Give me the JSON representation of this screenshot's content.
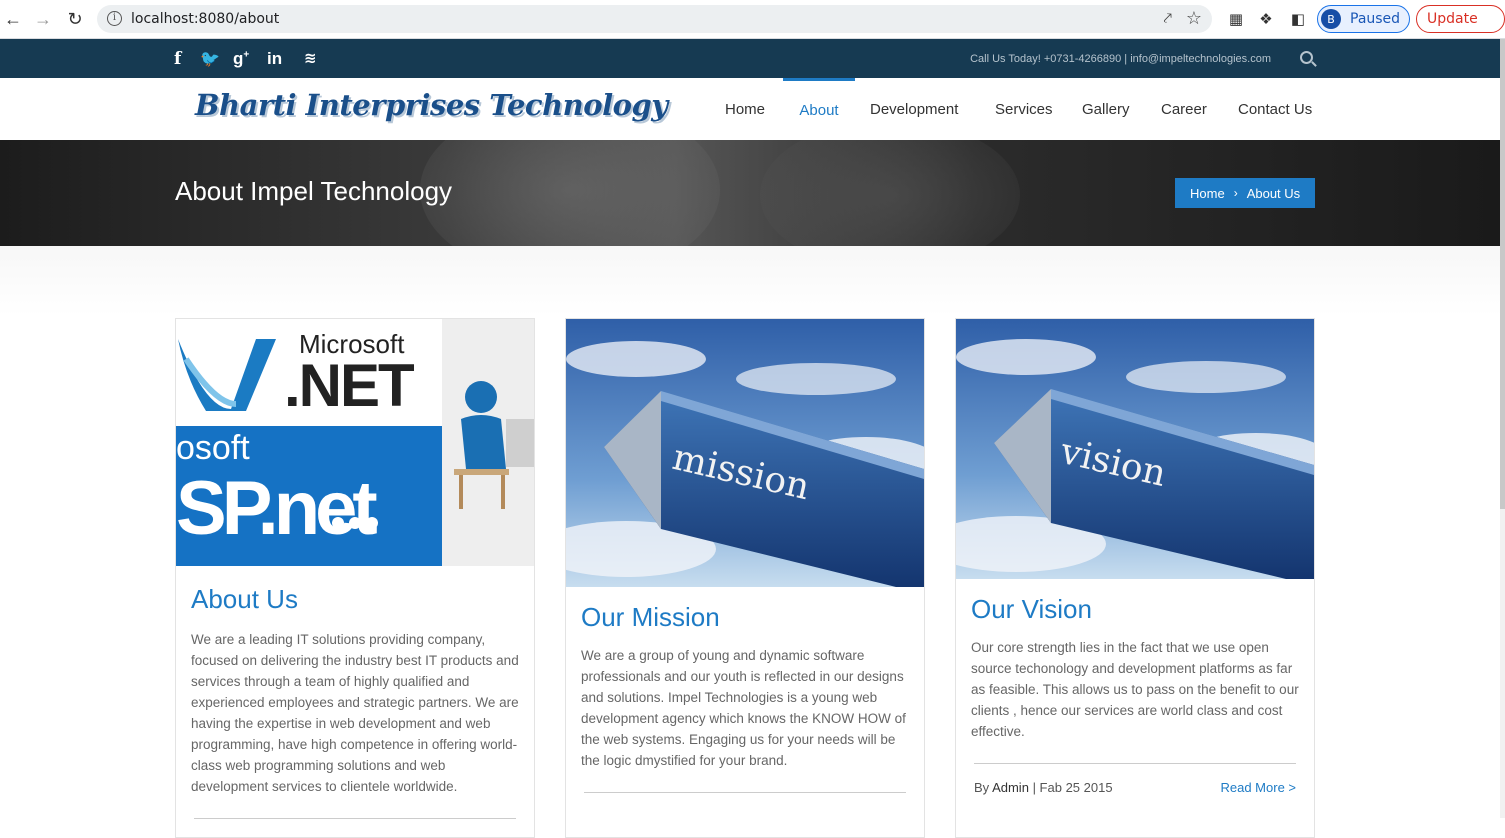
{
  "browser": {
    "url": "localhost:8080/about",
    "profile_initial": "B",
    "profile_status": "Paused",
    "update_label": "Update"
  },
  "topbar": {
    "contact": "Call Us Today! +0731-4266890 | info@impeltechnologies.com",
    "social": [
      "facebook",
      "twitter",
      "google-plus",
      "linkedin",
      "rss"
    ]
  },
  "header": {
    "logo": "Bharti Interprises Technology",
    "menu": [
      "Home",
      "About",
      "Development",
      "Services",
      "Gallery",
      "Career",
      "Contact Us"
    ],
    "active": "About"
  },
  "page": {
    "title": "About Impel Technology",
    "breadcrumb": [
      "Home",
      "About Us"
    ]
  },
  "cards": [
    {
      "image_texts": [
        "Microsoft",
        ".NET",
        "osoft",
        "SP.net"
      ],
      "title": "About Us",
      "body": "We are a leading IT solutions providing company, focused on delivering the industry best IT products and services through a team of highly qualified and experienced employees and strategic partners. We are having the expertise in web development and web programming, have high competence in offering world-class web programming solutions and web development services to clientele worldwide."
    },
    {
      "image_text": "mission",
      "title": "Our Mission",
      "body": "We are a group of young and dynamic software professionals and our youth is reflected in our designs and solutions. Impel Technologies is a young web development agency which knows the KNOW HOW of the web systems. Engaging us for your needs will be the logic dmystified for your brand."
    },
    {
      "image_text": "vision",
      "title": "Our Vision",
      "body": "Our core strength lies in the fact that we use open source techonology and development platforms as far as feasible. This allows us to pass on the benefit to our clients , hence our services are world class and cost effective.",
      "meta_by": "By",
      "meta_author": "Admin",
      "meta_date": "| Fab 25 2015",
      "meta_more": "Read More >"
    }
  ],
  "colors": {
    "accent": "#1e7bc5",
    "topbar": "#163a52"
  }
}
